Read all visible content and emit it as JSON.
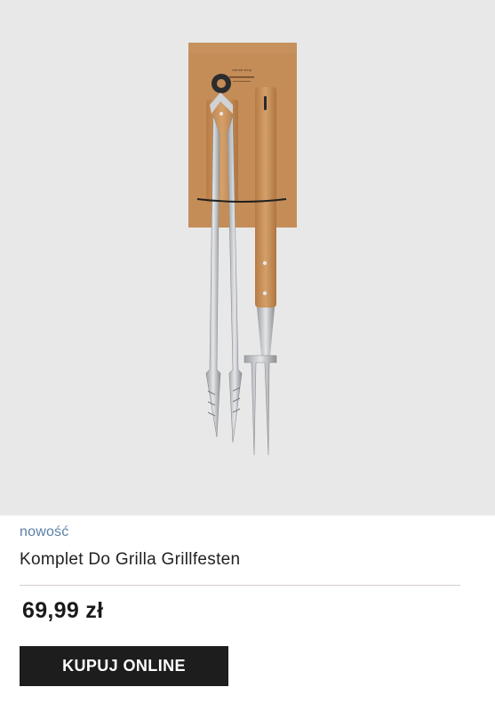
{
  "product": {
    "badge": "nowość",
    "title": "Komplet Do Grilla Grillfesten",
    "price": "69,99 zł",
    "buy_button_label": "KUPUJ ONLINE",
    "packaging_card_text": "natural shop"
  },
  "colors": {
    "image_background": "#e8e8e9",
    "badge": "#5b7fa6",
    "button_background": "#1d1d1d",
    "button_text": "#ffffff",
    "wood": "#c9925a",
    "card": "#c8935f"
  }
}
